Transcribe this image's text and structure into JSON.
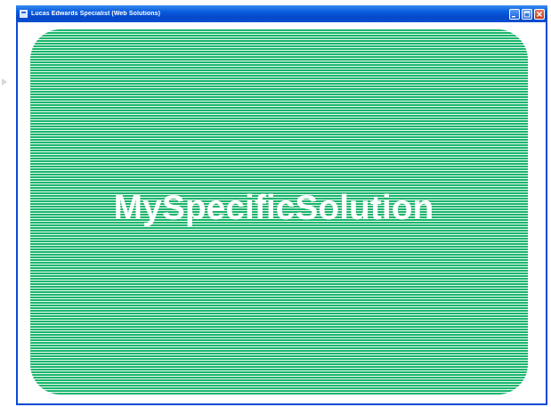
{
  "window": {
    "title": "Lucas Edwards Specialist (Web Solutions)",
    "controls": {
      "minimize_icon": "minimize-icon",
      "maximize_icon": "maximize-icon",
      "close_icon": "close-icon"
    }
  },
  "slide": {
    "title": "MySpecificSolution"
  },
  "colors": {
    "titlebar": "#0548c9",
    "panel_green": "#1bb56d",
    "panel_stripe": "#e9f8ef",
    "text": "#ffffff"
  }
}
